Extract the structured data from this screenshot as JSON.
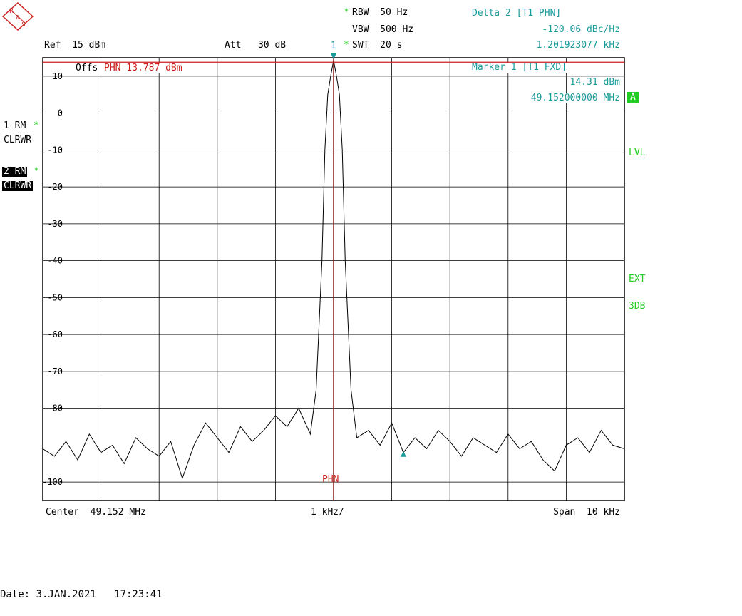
{
  "logo": {
    "text": "R&S",
    "letters": [
      "R",
      "&",
      "S"
    ]
  },
  "header": {
    "rbw": "RBW  50 Hz",
    "vbw": "VBW  500 Hz",
    "swt": "SWT  20 s",
    "ref": "Ref  15 dBm",
    "att": "Att   30 dB",
    "marker_flag": "1"
  },
  "delta_marker": {
    "title": "Delta 2 [T1 PHN]",
    "value": "-120.06 dBc/Hz",
    "freq": "1.201923077 kHz"
  },
  "marker1": {
    "title": "Marker 1 [T1 FXD]",
    "level": "14.31 dBm",
    "freq": "49.152000000 MHz"
  },
  "offset_text": "Offs",
  "phn_label": "PHN 13.787 dBm",
  "phn_bottom": "PHN",
  "left_panel": {
    "trace1": "1 RM",
    "trace1_mode": "CLRWR",
    "trace2": "2 RM",
    "trace2_mode": "CLRWR",
    "star": "*"
  },
  "right_panel": {
    "a_badge": "A",
    "lvl": "LVL",
    "ext": "EXT",
    "db3": "3DB"
  },
  "footer": {
    "center": "Center  49.152 MHz",
    "div": "1 kHz/",
    "span": "Span  10 kHz",
    "date": "Date: 3.JAN.2021   17:23:41"
  },
  "colors": {
    "trace": "#000000",
    "grid": "#000000",
    "marker": "#1a9a9a",
    "phn_line": "#cc2020",
    "phn_vline": "#8b1a1a",
    "status_green": "#22cc22"
  },
  "chart_data": {
    "type": "line",
    "xlabel": "",
    "ylabel": "",
    "x_unit": "kHz offset from center",
    "xlim": [
      -5,
      5
    ],
    "ylim": [
      -105,
      15
    ],
    "grid": true,
    "ytick_labels": [
      "10",
      "0",
      "-10",
      "-20",
      "-30",
      "-40",
      "-50",
      "-60",
      "-70",
      "-80",
      "-100"
    ],
    "ytick_values": [
      10,
      0,
      -10,
      -20,
      -30,
      -40,
      -50,
      -60,
      -70,
      -80,
      -100
    ],
    "ref_level_dbm": 13.787,
    "marker1": {
      "x": 0,
      "y": 14.31
    },
    "delta2_marker": {
      "x": 1.2,
      "y": -92
    },
    "series": [
      {
        "x": [
          -5,
          -4.8,
          -4.6,
          -4.4,
          -4.2,
          -4,
          -3.8,
          -3.6,
          -3.4,
          -3.2,
          -3,
          -2.8,
          -2.6,
          -2.4,
          -2.2,
          -2,
          -1.8,
          -1.6,
          -1.4,
          -1.2,
          -1,
          -0.8,
          -0.6,
          -0.4,
          -0.3,
          -0.2,
          -0.15,
          -0.1,
          -0.05,
          0,
          0.05,
          0.1,
          0.15,
          0.2,
          0.3,
          0.4,
          0.6,
          0.8,
          1,
          1.2,
          1.4,
          1.6,
          1.8,
          2,
          2.2,
          2.4,
          2.6,
          2.8,
          3,
          3.2,
          3.4,
          3.6,
          3.8,
          4,
          4.2,
          4.4,
          4.6,
          4.8,
          5
        ],
        "values": [
          -91,
          -93,
          -89,
          -94,
          -87,
          -92,
          -90,
          -95,
          -88,
          -91,
          -93,
          -89,
          -99,
          -90,
          -84,
          -88,
          -92,
          -85,
          -89,
          -86,
          -82,
          -85,
          -80,
          -87,
          -75,
          -40,
          -10,
          5,
          10,
          14.31,
          10,
          5,
          -10,
          -40,
          -75,
          -88,
          -86,
          -90,
          -84,
          -92,
          -88,
          -91,
          -86,
          -89,
          -93,
          -88,
          -90,
          -92,
          -87,
          -91,
          -89,
          -94,
          -97,
          -90,
          -88,
          -92,
          -86,
          -90,
          -91
        ]
      }
    ]
  }
}
